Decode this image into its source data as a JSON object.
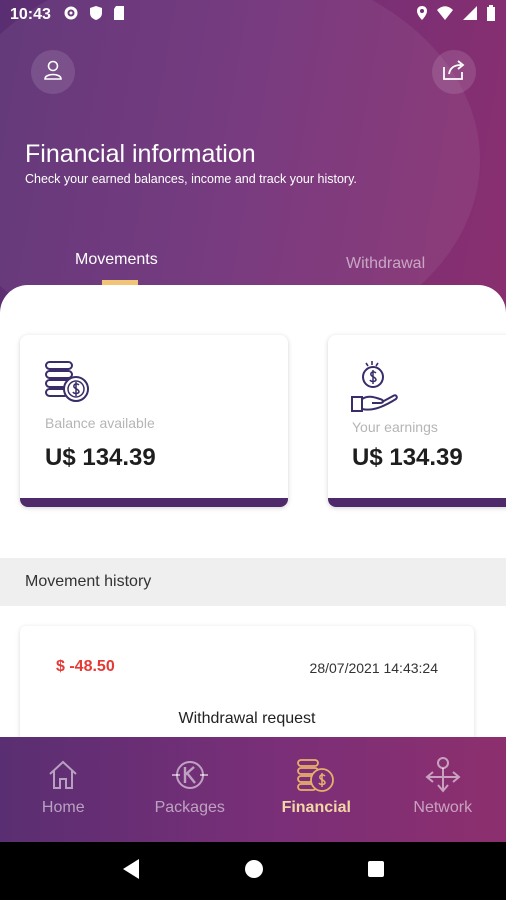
{
  "status_bar": {
    "time": "10:43"
  },
  "header": {
    "title": "Financial information",
    "subtitle": "Check your earned balances, income and track your history."
  },
  "tabs": [
    {
      "label": "Movements",
      "active": true
    },
    {
      "label": "Withdrawal",
      "active": false
    }
  ],
  "cards": [
    {
      "label": "Balance available",
      "value": "U$ 134.39",
      "icon": "coins-stack-icon"
    },
    {
      "label": "Your earnings",
      "value": "U$ 134.39",
      "icon": "hand-money-icon"
    }
  ],
  "history": {
    "title": "Movement history",
    "items": [
      {
        "amount": "$ -48.50",
        "date": "28/07/2021 14:43:24",
        "description": "Withdrawal request"
      }
    ]
  },
  "bottom_nav": [
    {
      "label": "Home",
      "icon": "home-icon",
      "active": false
    },
    {
      "label": "Packages",
      "icon": "packages-icon",
      "active": false
    },
    {
      "label": "Financial",
      "icon": "financial-icon",
      "active": true
    },
    {
      "label": "Network",
      "icon": "network-icon",
      "active": false
    }
  ],
  "colors": {
    "primary": "#6f2f78",
    "accent": "#f2c477",
    "negative": "#e53935",
    "card_border": "#4e2a6a"
  }
}
